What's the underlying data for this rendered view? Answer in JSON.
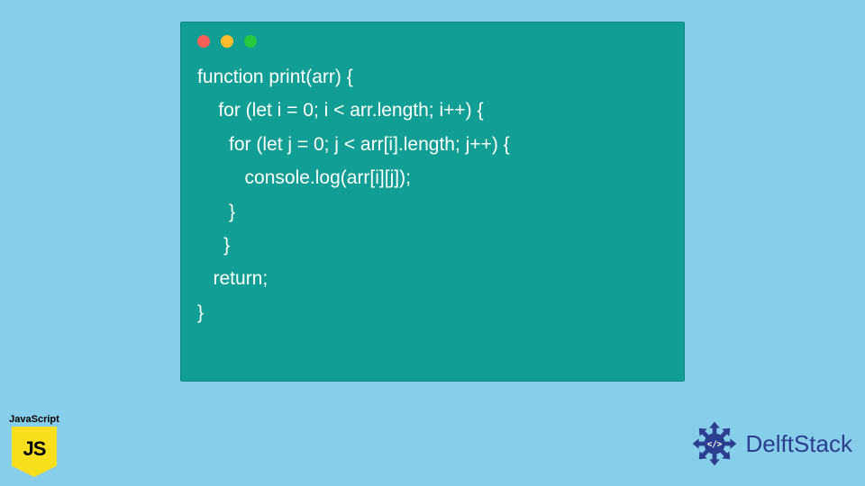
{
  "code": {
    "lines": [
      "function print(arr) {",
      "    for (let i = 0; i < arr.length; i++) {",
      "     for (let j = 0; j < arr[i].length; j++) {",
      "       console.log(arr[i][j]);",
      "     }",
      "    }",
      "   return;",
      "}"
    ]
  },
  "js_badge": {
    "label": "JavaScript",
    "icon_text": "JS"
  },
  "brand": {
    "text": "DelftStack"
  },
  "colors": {
    "bg": "#87ceeb",
    "window": "#119e95",
    "js": "#f7df1e",
    "brand": "#2c3e8f"
  }
}
